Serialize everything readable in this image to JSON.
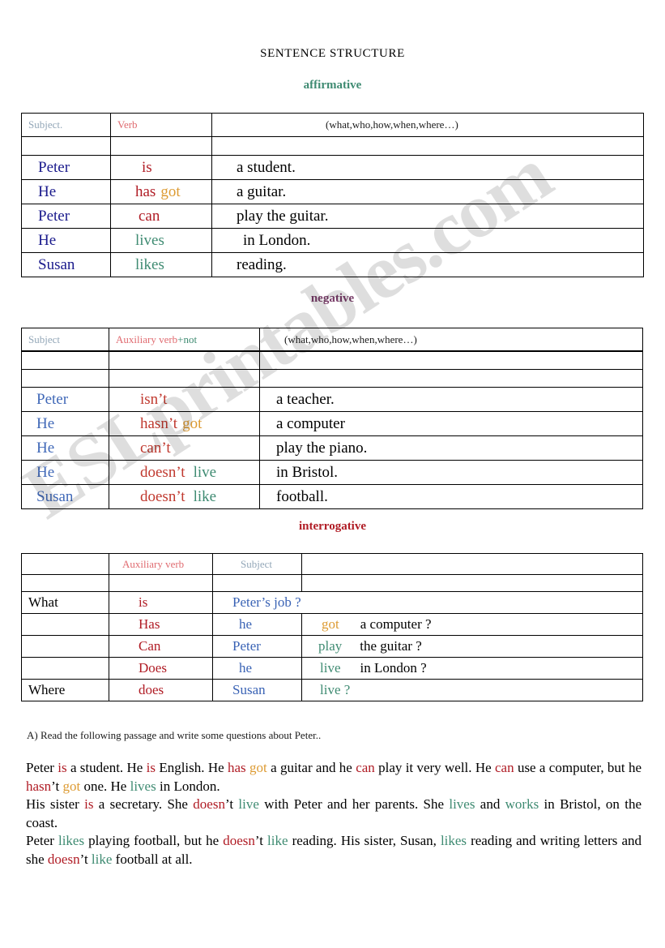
{
  "document": {
    "title": "SENTENCE STRUCTURE",
    "watermark": "ESLprintables.com"
  },
  "sections": {
    "affirmative": {
      "label": "affirmative",
      "color": "#3f8b72"
    },
    "negative": {
      "label": "negative",
      "color": "#7b3f6b"
    },
    "interrogative": {
      "label": "interrogative",
      "color": "#b01c25"
    }
  },
  "affirmative_table": {
    "headers": {
      "subject": "Subject.",
      "verb": "Verb",
      "complement": "(what,who,how,when,where…)"
    },
    "rows": [
      {
        "subject": "Peter",
        "verb": "is",
        "verb2": "",
        "complement": "a student."
      },
      {
        "subject": "He",
        "verb": "has",
        "verb2": "got",
        "complement": "a guitar."
      },
      {
        "subject": "Peter",
        "verb": "can",
        "verb2": "",
        "complement": "play the guitar."
      },
      {
        "subject": "He",
        "verb": "lives",
        "verb2": "",
        "complement": "in London."
      },
      {
        "subject": "Susan",
        "verb": "likes",
        "verb2": "",
        "complement": "reading."
      }
    ]
  },
  "negative_table": {
    "headers": {
      "subject": "Subject",
      "auxiliary": "Auxiliary verb",
      "not": "+not",
      "complement": "(what,who,how,when,where…)"
    },
    "rows": [
      {
        "subject": "Peter",
        "auxiliary": "isn’t",
        "verb": "",
        "complement": "a teacher."
      },
      {
        "subject": "He",
        "auxiliary": "hasn’t",
        "verb": "got",
        "complement": "a computer"
      },
      {
        "subject": "He",
        "auxiliary": "can’t",
        "verb": "",
        "complement": "play the piano."
      },
      {
        "subject": "He",
        "auxiliary": "doesn’t",
        "verb": "live",
        "complement": "in Bristol."
      },
      {
        "subject": "Susan",
        "auxiliary": "doesn’t",
        "verb": "like",
        "complement": "football."
      }
    ]
  },
  "interrogative_table": {
    "headers": {
      "question_word": "",
      "auxiliary": "Auxiliary verb",
      "subject": "Subject",
      "verb": "",
      "complement": ""
    },
    "rows": [
      {
        "question_word": "What",
        "auxiliary": "is",
        "subject": "Peter’s job ?",
        "verb": "",
        "complement": ""
      },
      {
        "question_word": "",
        "auxiliary": "Has",
        "subject": "he",
        "verb": "got",
        "complement": "a computer ?"
      },
      {
        "question_word": "",
        "auxiliary": "Can",
        "subject": "Peter",
        "verb": "play",
        "complement": "the guitar ?"
      },
      {
        "question_word": "",
        "auxiliary": "Does",
        "subject": "he",
        "verb": "live",
        "complement": "in London ?"
      },
      {
        "question_word": "Where",
        "auxiliary": "does",
        "subject": "Susan",
        "verb": "live ?",
        "complement": ""
      }
    ]
  },
  "exercise": {
    "instruction": "A) Read the following passage and write some questions about Peter..",
    "paragraphs": [
      {
        "id": "p1",
        "parts": [
          {
            "t": "Peter ",
            "c": "black"
          },
          {
            "t": "is",
            "c": "red"
          },
          {
            "t": " a student. He ",
            "c": "black"
          },
          {
            "t": "is",
            "c": "red"
          },
          {
            "t": " English. He ",
            "c": "black"
          },
          {
            "t": "has",
            "c": "red"
          },
          {
            "t": " ",
            "c": "black"
          },
          {
            "t": "got",
            "c": "gold"
          },
          {
            "t": " a guitar and he ",
            "c": "black"
          },
          {
            "t": "can",
            "c": "red"
          },
          {
            "t": " play it very well. He ",
            "c": "black"
          },
          {
            "t": "can",
            "c": "red"
          },
          {
            "t": " use a computer, but he ",
            "c": "black"
          },
          {
            "t": "hasn",
            "c": "red"
          },
          {
            "t": "’t ",
            "c": "black"
          },
          {
            "t": "got",
            "c": "gold"
          },
          {
            "t": " one.  He ",
            "c": "black"
          },
          {
            "t": "lives",
            "c": "green"
          },
          {
            "t": " in London.",
            "c": "black"
          }
        ]
      },
      {
        "id": "p2",
        "parts": [
          {
            "t": "His sister ",
            "c": "black"
          },
          {
            "t": "is",
            "c": "red"
          },
          {
            "t": " a secretary. She ",
            "c": "black"
          },
          {
            "t": "doesn",
            "c": "red"
          },
          {
            "t": "’t ",
            "c": "black"
          },
          {
            "t": "live",
            "c": "green"
          },
          {
            "t": " with Peter and her parents. She ",
            "c": "black"
          },
          {
            "t": "lives",
            "c": "green"
          },
          {
            "t": "  and ",
            "c": "black"
          },
          {
            "t": "works",
            "c": "green"
          },
          {
            "t": " in Bristol, on the coast.",
            "c": "black"
          }
        ]
      },
      {
        "id": "p3",
        "parts": [
          {
            "t": "Peter ",
            "c": "black"
          },
          {
            "t": "likes",
            "c": "green"
          },
          {
            "t": " playing football, but he ",
            "c": "black"
          },
          {
            "t": "doesn",
            "c": "red"
          },
          {
            "t": "’t ",
            "c": "black"
          },
          {
            "t": "like",
            "c": "green"
          },
          {
            "t": " reading. His sister, Susan, ",
            "c": "black"
          },
          {
            "t": "likes",
            "c": "green"
          },
          {
            "t": " reading and writing letters and she ",
            "c": "black"
          },
          {
            "t": "doesn",
            "c": "red"
          },
          {
            "t": "’t ",
            "c": "black"
          },
          {
            "t": "like",
            "c": "green"
          },
          {
            "t": " football at all.",
            "c": "black"
          }
        ]
      }
    ]
  },
  "colors": {
    "green": "#3f8b72",
    "red": "#b01c25",
    "gold": "#dd9b33",
    "blue": "#1a1a8c",
    "purple": "#7b3f6b",
    "header_gray": "#93a7b8"
  }
}
